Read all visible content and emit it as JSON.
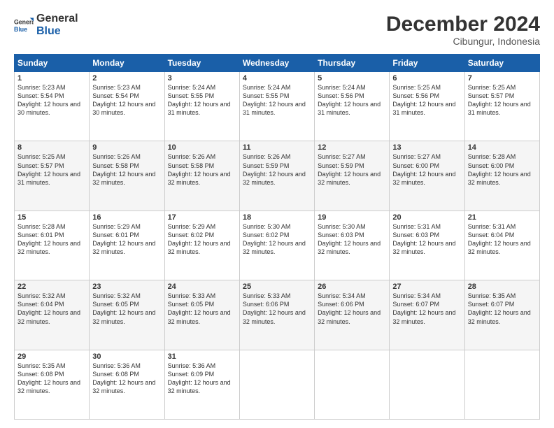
{
  "header": {
    "logo_line1": "General",
    "logo_line2": "Blue",
    "title": "December 2024",
    "subtitle": "Cibungur, Indonesia"
  },
  "calendar": {
    "days_of_week": [
      "Sunday",
      "Monday",
      "Tuesday",
      "Wednesday",
      "Thursday",
      "Friday",
      "Saturday"
    ],
    "weeks": [
      [
        null,
        {
          "day": "1",
          "sunrise": "5:23 AM",
          "sunset": "5:54 PM",
          "daylight": "12 hours and 30 minutes."
        },
        {
          "day": "2",
          "sunrise": "5:23 AM",
          "sunset": "5:54 PM",
          "daylight": "12 hours and 30 minutes."
        },
        {
          "day": "3",
          "sunrise": "5:24 AM",
          "sunset": "5:55 PM",
          "daylight": "12 hours and 31 minutes."
        },
        {
          "day": "4",
          "sunrise": "5:24 AM",
          "sunset": "5:55 PM",
          "daylight": "12 hours and 31 minutes."
        },
        {
          "day": "5",
          "sunrise": "5:24 AM",
          "sunset": "5:56 PM",
          "daylight": "12 hours and 31 minutes."
        },
        {
          "day": "6",
          "sunrise": "5:25 AM",
          "sunset": "5:56 PM",
          "daylight": "12 hours and 31 minutes."
        },
        {
          "day": "7",
          "sunrise": "5:25 AM",
          "sunset": "5:57 PM",
          "daylight": "12 hours and 31 minutes."
        }
      ],
      [
        {
          "day": "8",
          "sunrise": "5:25 AM",
          "sunset": "5:57 PM",
          "daylight": "12 hours and 31 minutes."
        },
        {
          "day": "9",
          "sunrise": "5:26 AM",
          "sunset": "5:58 PM",
          "daylight": "12 hours and 32 minutes."
        },
        {
          "day": "10",
          "sunrise": "5:26 AM",
          "sunset": "5:58 PM",
          "daylight": "12 hours and 32 minutes."
        },
        {
          "day": "11",
          "sunrise": "5:26 AM",
          "sunset": "5:59 PM",
          "daylight": "12 hours and 32 minutes."
        },
        {
          "day": "12",
          "sunrise": "5:27 AM",
          "sunset": "5:59 PM",
          "daylight": "12 hours and 32 minutes."
        },
        {
          "day": "13",
          "sunrise": "5:27 AM",
          "sunset": "6:00 PM",
          "daylight": "12 hours and 32 minutes."
        },
        {
          "day": "14",
          "sunrise": "5:28 AM",
          "sunset": "6:00 PM",
          "daylight": "12 hours and 32 minutes."
        }
      ],
      [
        {
          "day": "15",
          "sunrise": "5:28 AM",
          "sunset": "6:01 PM",
          "daylight": "12 hours and 32 minutes."
        },
        {
          "day": "16",
          "sunrise": "5:29 AM",
          "sunset": "6:01 PM",
          "daylight": "12 hours and 32 minutes."
        },
        {
          "day": "17",
          "sunrise": "5:29 AM",
          "sunset": "6:02 PM",
          "daylight": "12 hours and 32 minutes."
        },
        {
          "day": "18",
          "sunrise": "5:30 AM",
          "sunset": "6:02 PM",
          "daylight": "12 hours and 32 minutes."
        },
        {
          "day": "19",
          "sunrise": "5:30 AM",
          "sunset": "6:03 PM",
          "daylight": "12 hours and 32 minutes."
        },
        {
          "day": "20",
          "sunrise": "5:31 AM",
          "sunset": "6:03 PM",
          "daylight": "12 hours and 32 minutes."
        },
        {
          "day": "21",
          "sunrise": "5:31 AM",
          "sunset": "6:04 PM",
          "daylight": "12 hours and 32 minutes."
        }
      ],
      [
        {
          "day": "22",
          "sunrise": "5:32 AM",
          "sunset": "6:04 PM",
          "daylight": "12 hours and 32 minutes."
        },
        {
          "day": "23",
          "sunrise": "5:32 AM",
          "sunset": "6:05 PM",
          "daylight": "12 hours and 32 minutes."
        },
        {
          "day": "24",
          "sunrise": "5:33 AM",
          "sunset": "6:05 PM",
          "daylight": "12 hours and 32 minutes."
        },
        {
          "day": "25",
          "sunrise": "5:33 AM",
          "sunset": "6:06 PM",
          "daylight": "12 hours and 32 minutes."
        },
        {
          "day": "26",
          "sunrise": "5:34 AM",
          "sunset": "6:06 PM",
          "daylight": "12 hours and 32 minutes."
        },
        {
          "day": "27",
          "sunrise": "5:34 AM",
          "sunset": "6:07 PM",
          "daylight": "12 hours and 32 minutes."
        },
        {
          "day": "28",
          "sunrise": "5:35 AM",
          "sunset": "6:07 PM",
          "daylight": "12 hours and 32 minutes."
        }
      ],
      [
        {
          "day": "29",
          "sunrise": "5:35 AM",
          "sunset": "6:08 PM",
          "daylight": "12 hours and 32 minutes."
        },
        {
          "day": "30",
          "sunrise": "5:36 AM",
          "sunset": "6:08 PM",
          "daylight": "12 hours and 32 minutes."
        },
        {
          "day": "31",
          "sunrise": "5:36 AM",
          "sunset": "6:09 PM",
          "daylight": "12 hours and 32 minutes."
        },
        null,
        null,
        null,
        null
      ]
    ]
  }
}
